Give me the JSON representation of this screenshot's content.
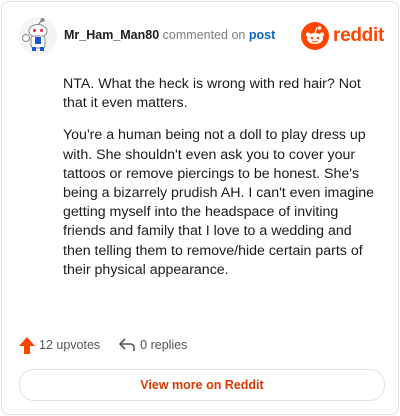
{
  "header": {
    "author": "Mr_Ham_Man80",
    "commented_on": "commented on",
    "post_link": "post",
    "brand": "reddit"
  },
  "comment": {
    "paragraphs": [
      "NTA. What the heck is wrong with red hair? Not that it even matters.",
      "You're a human being not a doll to play dress up with. She shouldn't even ask you to cover your tattoos or remove piercings to be honest. She's being a bizarrely prudish AH. I can't even imagine getting myself into the headspace of inviting friends and family that I love to a wedding and then telling them to remove/hide certain parts of their physical appearance."
    ]
  },
  "footer": {
    "upvotes": "12 upvotes",
    "replies": "0 replies",
    "view_more": "View more on Reddit"
  },
  "icons": {
    "avatar": "snoo-avatar-icon",
    "brand": "reddit-logo-icon",
    "upvote": "upvote-arrow-icon",
    "reply": "reply-arrow-icon"
  },
  "colors": {
    "brand": "#ff4500",
    "link": "#0a66c2",
    "view_more_text": "#d93a00",
    "upvote": "#ff4500"
  }
}
